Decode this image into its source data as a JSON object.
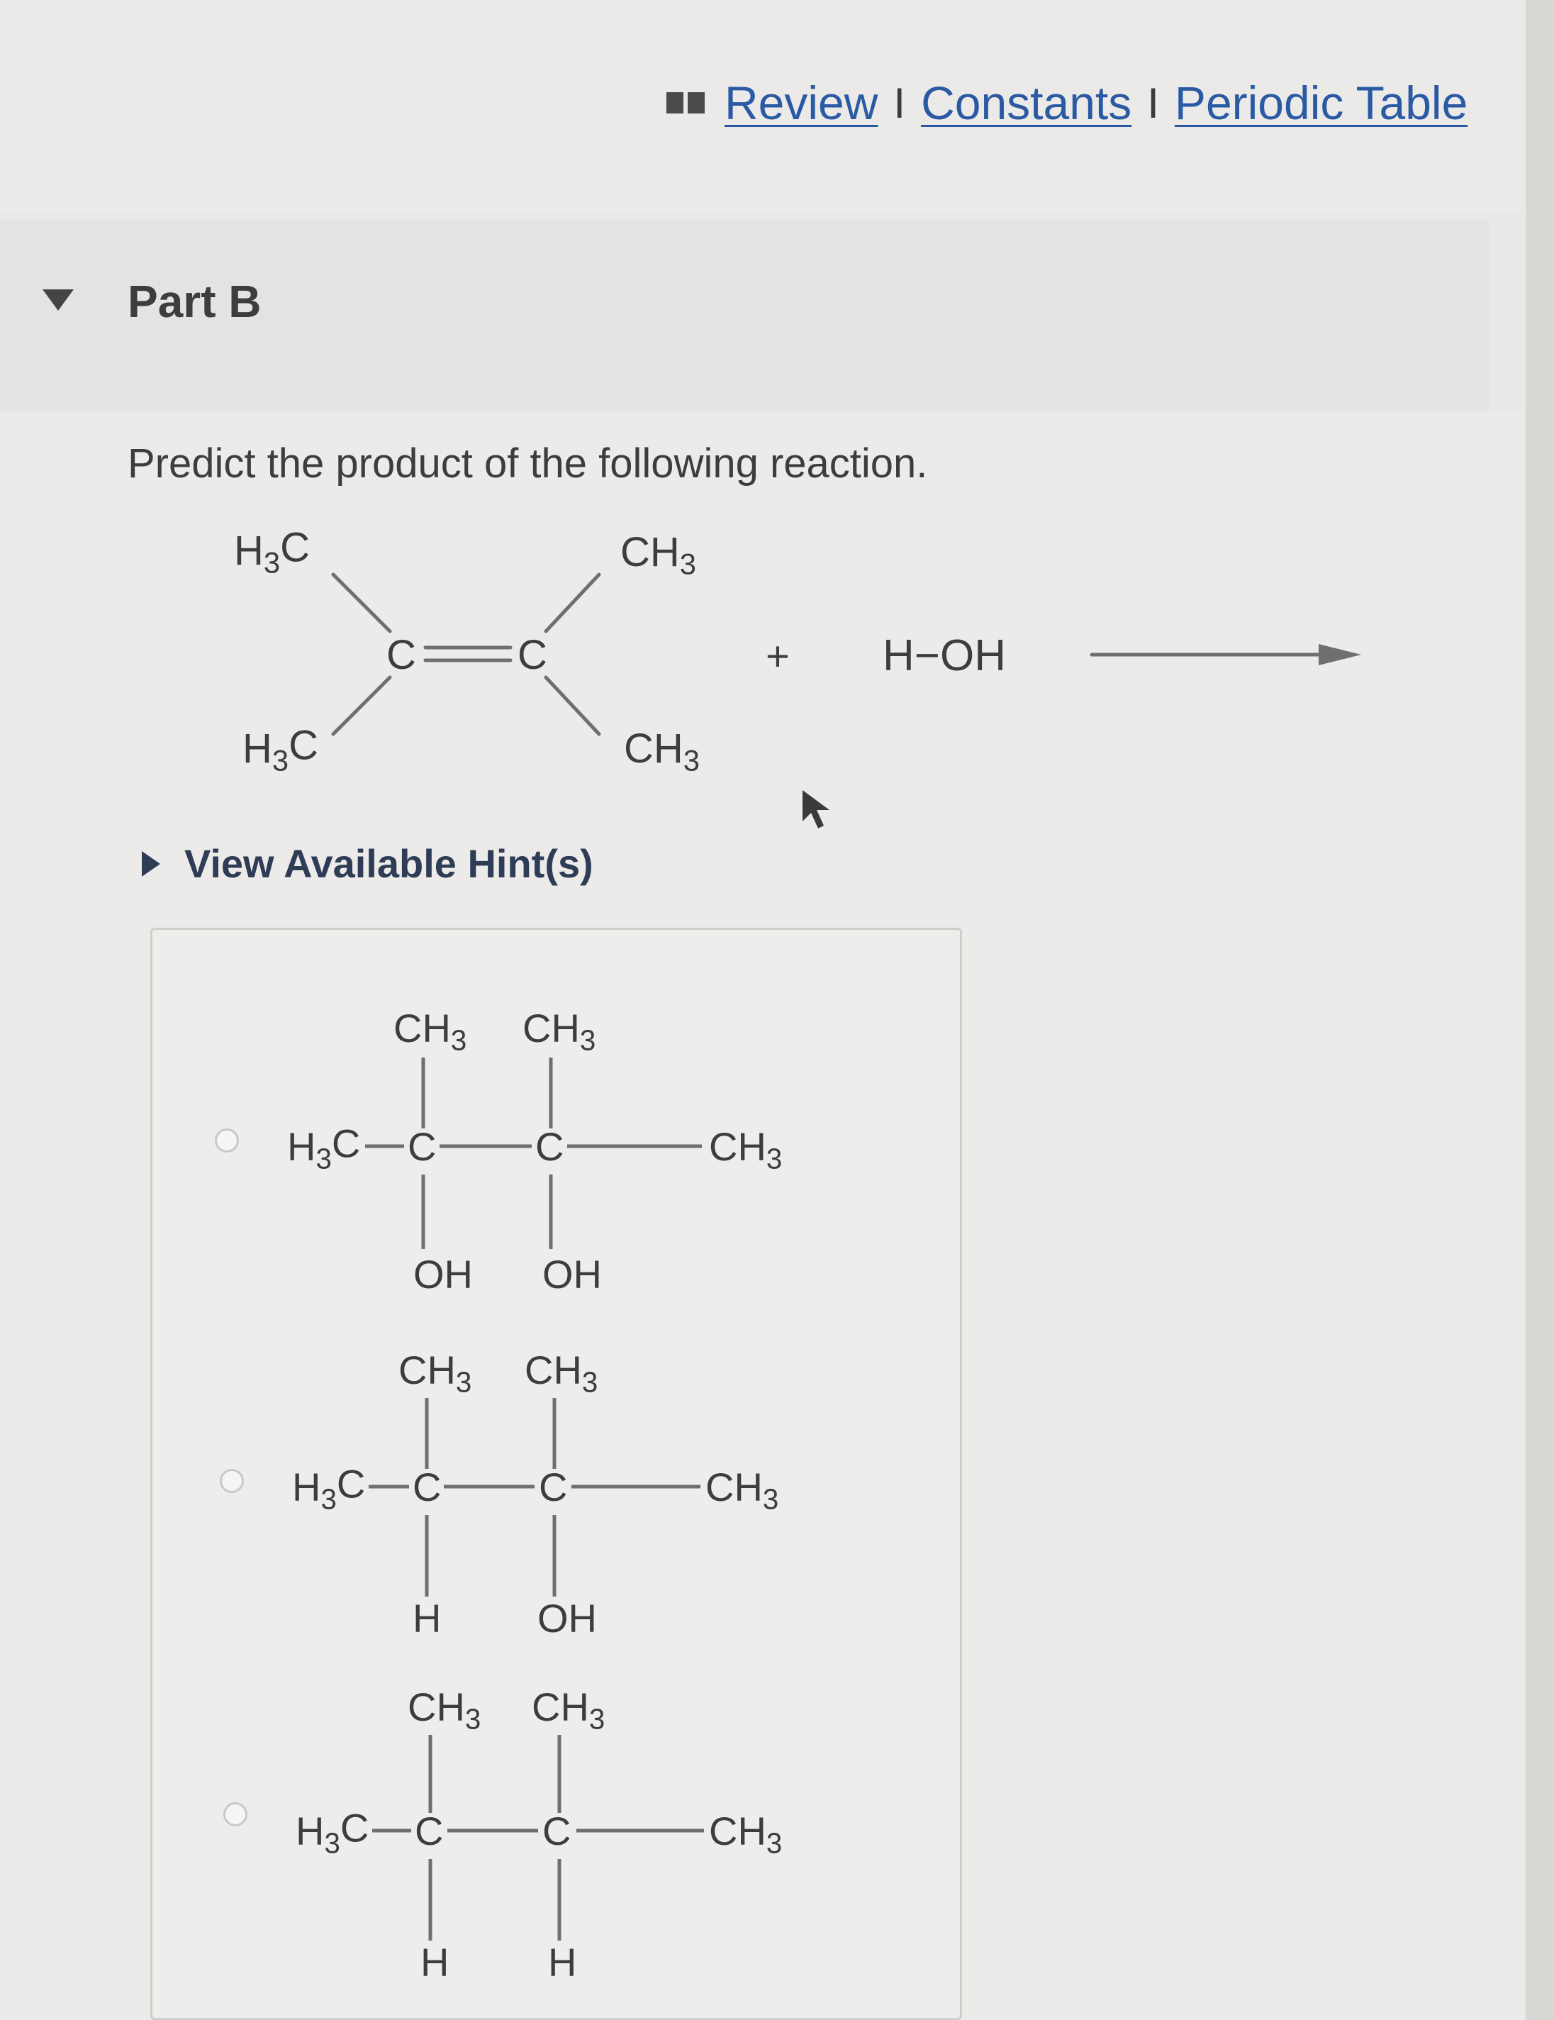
{
  "header": {
    "links": [
      {
        "label": "Review"
      },
      {
        "label": "Constants"
      },
      {
        "label": "Periodic Table"
      }
    ],
    "separator": "I"
  },
  "part": {
    "title": "Part B",
    "question": "Predict the product of the following reaction."
  },
  "reaction": {
    "reactant_groups": {
      "top_left": "H3C",
      "bottom_left": "H3C",
      "top_right": "CH3",
      "bottom_right": "CH3",
      "carbon": "C"
    },
    "plus": "+",
    "reagent": "H−OH"
  },
  "hint": {
    "label": "View Available Hint(s)"
  },
  "options": [
    {
      "top1": "CH3",
      "top2": "CH3",
      "left": "H3C",
      "c1": "C",
      "c2": "C",
      "right": "CH3",
      "bottom1": "OH",
      "bottom2": "OH"
    },
    {
      "top1": "CH3",
      "top2": "CH3",
      "left": "H3C",
      "c1": "C",
      "c2": "C",
      "right": "CH3",
      "bottom1": "H",
      "bottom2": "OH"
    },
    {
      "top1": "CH3",
      "top2": "CH3",
      "left": "H3C",
      "c1": "C",
      "c2": "C",
      "right": "CH3",
      "bottom1": "H",
      "bottom2": "H"
    }
  ],
  "colors": {
    "link": "#2b5aa4",
    "hint": "#2e3c56",
    "text": "#3d3d3d",
    "bond": "#6f6f6f"
  },
  "icons": [
    "book-icon",
    "triangle-down-icon",
    "triangle-right-icon",
    "radio-icon",
    "arrow-right-icon",
    "mouse-pointer-icon"
  ]
}
